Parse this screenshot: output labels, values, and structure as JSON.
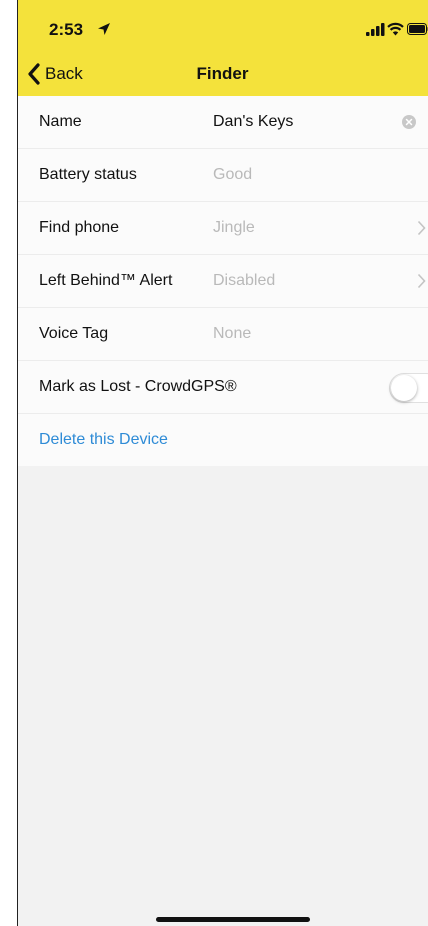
{
  "status_bar": {
    "time": "2:53"
  },
  "nav": {
    "back_label": "Back",
    "title": "Finder"
  },
  "settings": {
    "name": {
      "label": "Name",
      "value": "Dan's Keys"
    },
    "battery": {
      "label": "Battery status",
      "value": "Good"
    },
    "find_phone": {
      "label": "Find phone",
      "value": "Jingle"
    },
    "left_behind": {
      "label": "Left Behind™ Alert",
      "value": "Disabled"
    },
    "voice_tag": {
      "label": "Voice Tag",
      "value": "None"
    },
    "mark_lost": {
      "label": "Mark as Lost - CrowdGPS®",
      "enabled": false
    }
  },
  "delete_label": "Delete this Device",
  "colors": {
    "header": "#f4e23b",
    "link": "#2e8bd6",
    "background": "#f2f2f2"
  }
}
